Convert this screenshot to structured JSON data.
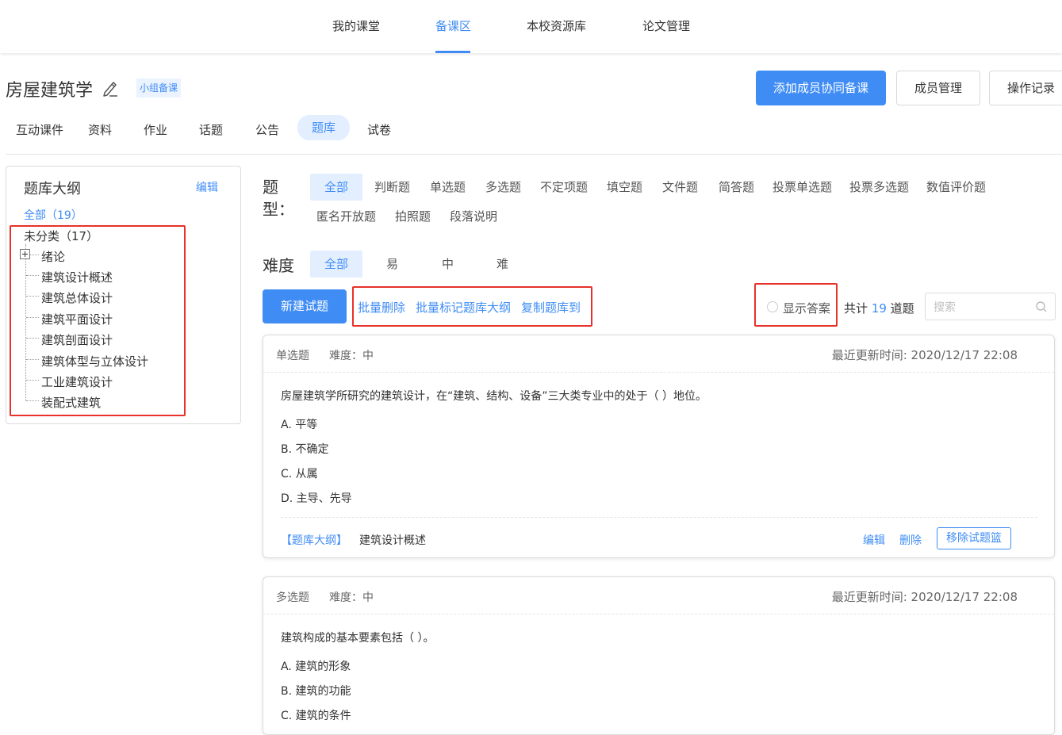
{
  "topnav": {
    "items": [
      "我的课堂",
      "备课区",
      "本校资源库",
      "论文管理"
    ],
    "active_index": 1
  },
  "header": {
    "course_title": "房屋建筑学",
    "group_tag": "小组备课",
    "add_member_button": "添加成员协同备课",
    "member_manage_button": "成员管理",
    "operation_log_button": "操作记录"
  },
  "subtabs": {
    "items": [
      "互动课件",
      "资料",
      "作业",
      "话题",
      "公告",
      "题库",
      "试卷"
    ],
    "active_index": 5
  },
  "sidebar": {
    "title": "题库大纲",
    "edit": "编辑",
    "all": "全部（19）",
    "uncategorized": "未分类（17）",
    "items": [
      "绪论",
      "建筑设计概述",
      "建筑总体设计",
      "建筑平面设计",
      "建筑剖面设计",
      "建筑体型与立体设计",
      "工业建筑设计",
      "装配式建筑"
    ]
  },
  "filters": {
    "type_label": "题型：",
    "types_row1": [
      "全部",
      "判断题",
      "单选题",
      "多选题",
      "不定项题",
      "填空题",
      "文件题",
      "简答题",
      "投票单选题",
      "投票多选题",
      "数值评价题"
    ],
    "types_row2": [
      "匿名开放题",
      "拍照题",
      "段落说明"
    ],
    "difficulty_label": "难度",
    "difficulties": [
      "全部",
      "易",
      "中",
      "难"
    ]
  },
  "actions": {
    "new_question": "新建试题",
    "batch_delete": "批量删除",
    "batch_mark": "批量标记题库大纲",
    "copy_to": "复制题库到",
    "show_answer": "显示答案",
    "total_prefix": "共计",
    "total_count": "19",
    "total_suffix": "道题",
    "search_placeholder": "搜索"
  },
  "questions": [
    {
      "type": "单选题",
      "difficulty": "难度：中",
      "updated": "最近更新时间: 2020/12/17 22:08",
      "stem": "房屋建筑学所研究的建筑设计，在“建筑、结构、设备”三大类专业中的处于（  ）地位。",
      "options": [
        "A.  平等",
        "B.  不确定",
        "C.  从属",
        "D.  主导、先导"
      ],
      "outline_tag": "【题库大纲】",
      "outline_name": "建筑设计概述",
      "edit": "编辑",
      "delete": "删除",
      "remove": "移除试题篮"
    },
    {
      "type": "多选题",
      "difficulty": "难度：中",
      "updated": "最近更新时间: 2020/12/17 22:08",
      "stem": "建筑构成的基本要素包括（  ）。",
      "options": [
        "A.  建筑的形象",
        "B.  建筑的功能",
        "C.  建筑的条件"
      ]
    }
  ],
  "colors": {
    "accent": "#3f8cf5",
    "highlight_box": "#e8312a",
    "active_bg": "#e3efff"
  }
}
